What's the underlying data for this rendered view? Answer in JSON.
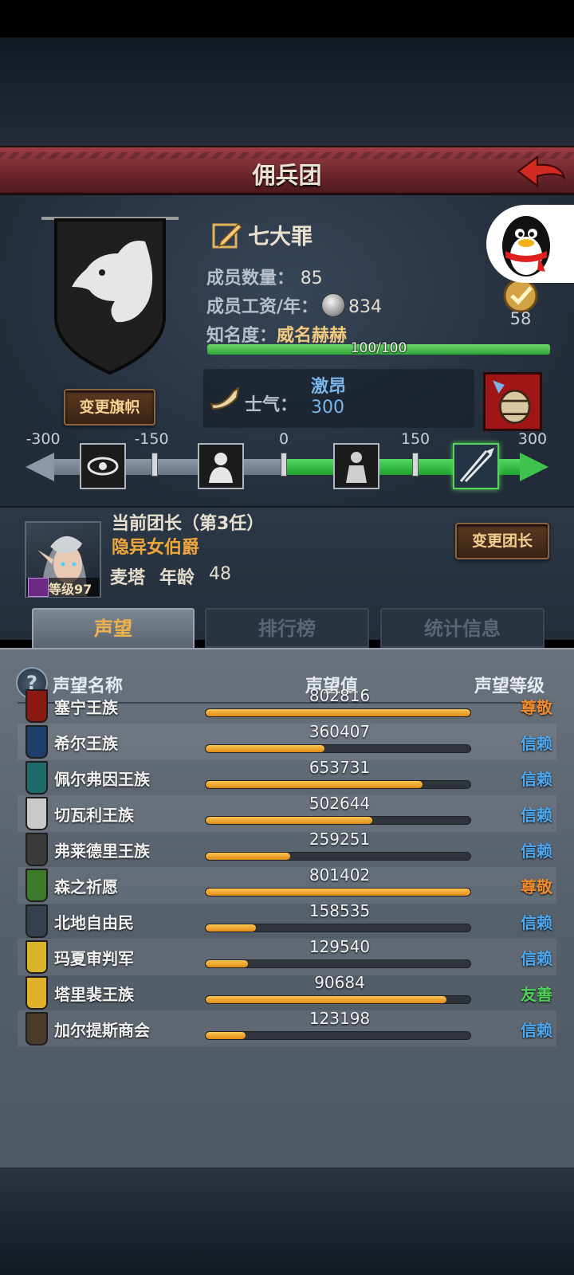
{
  "header": {
    "title": "佣兵团"
  },
  "guild": {
    "name": "七大罪",
    "members_label": "成员数量：",
    "members_value": "85",
    "salary_label": "成员工资/年：",
    "salary_value": "834",
    "fame_label": "知名度：",
    "fame_value": "威名赫赫",
    "fame_progress_text": "100/100",
    "fame_progress": 1.0,
    "medal_count": "58",
    "change_flag_label": "变更旗帜"
  },
  "morale": {
    "label": "士气：",
    "state": "激昂",
    "value": "300",
    "current": 300,
    "ticks": [
      "-300",
      "-150",
      "0",
      "150",
      "300"
    ]
  },
  "captain": {
    "label": "当前团长（第3任）",
    "title": "隐异女伯爵",
    "name": "麦塔",
    "age_label": "年龄",
    "age_value": "48",
    "level_text": "等级97",
    "change_leader_label": "变更团长"
  },
  "tabs": [
    {
      "label": "声望",
      "active": true
    },
    {
      "label": "排行榜",
      "active": false
    },
    {
      "label": "统计信息",
      "active": false
    }
  ],
  "reputation": {
    "headers": {
      "name": "声望名称",
      "value": "声望值",
      "level": "声望等级"
    },
    "rows": [
      {
        "name": "塞宁王族",
        "value": "802816",
        "fill": 1.0,
        "level": "尊敬",
        "level_color": "#f08a2a",
        "crest": "#8b1a14"
      },
      {
        "name": "希尔王族",
        "value": "360407",
        "fill": 0.45,
        "level": "信赖",
        "level_color": "#4ea8f0",
        "crest": "#1f3f6a"
      },
      {
        "name": "佩尔弗因王族",
        "value": "653731",
        "fill": 0.82,
        "level": "信赖",
        "level_color": "#4ea8f0",
        "crest": "#1c6a6a"
      },
      {
        "name": "切瓦利王族",
        "value": "502644",
        "fill": 0.63,
        "level": "信赖",
        "level_color": "#4ea8f0",
        "crest": "#c9c9c9"
      },
      {
        "name": "弗莱德里王族",
        "value": "259251",
        "fill": 0.32,
        "level": "信赖",
        "level_color": "#4ea8f0",
        "crest": "#3a3a3a"
      },
      {
        "name": "森之祈愿",
        "value": "801402",
        "fill": 1.0,
        "level": "尊敬",
        "level_color": "#f08a2a",
        "crest": "#3a7a2a"
      },
      {
        "name": "北地自由民",
        "value": "158535",
        "fill": 0.19,
        "level": "信赖",
        "level_color": "#4ea8f0",
        "crest": "#34404e"
      },
      {
        "name": "玛夏审判军",
        "value": "129540",
        "fill": 0.16,
        "level": "信赖",
        "level_color": "#4ea8f0",
        "crest": "#d9b52a"
      },
      {
        "name": "塔里裴王族",
        "value": "90684",
        "fill": 0.91,
        "level": "友善",
        "level_color": "#4fd25a",
        "crest": "#e0b22a"
      },
      {
        "name": "加尔提斯商会",
        "value": "123198",
        "fill": 0.15,
        "level": "信赖",
        "level_color": "#4ea8f0",
        "crest": "#4a3a2a"
      }
    ]
  },
  "colors": {
    "accent_gold": "#f0a73a",
    "morale_blue": "#79b6ea",
    "header_red": "#6c262b"
  },
  "icons": [
    "back-arrow-icon",
    "wolf-banner-icon",
    "edit-icon",
    "coin-icon",
    "medal-icon",
    "horn-icon",
    "barrel-icon",
    "eye-icon",
    "despair-icon",
    "calm-icon",
    "rally-icon",
    "help-icon",
    "qq-penguin-icon"
  ]
}
